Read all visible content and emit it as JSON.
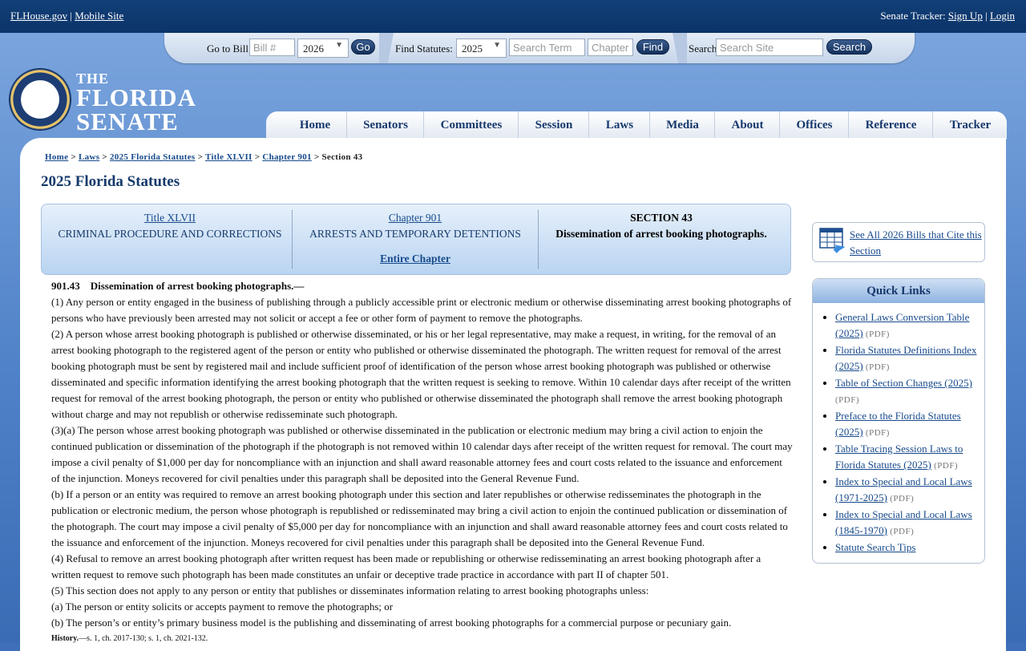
{
  "top": {
    "flhouse": "FLHouse.gov",
    "sep": "|",
    "mobile": "Mobile Site",
    "tracker_label": "Senate Tracker:",
    "sign_up": "Sign Up",
    "login": "Login"
  },
  "searchbar": {
    "goto_bill": "Go to Bill:",
    "bill_placeholder": "Bill #",
    "bill_year": "2026",
    "go": "Go",
    "find_statutes": "Find Statutes:",
    "statute_year": "2025",
    "term_placeholder": "Search Term",
    "chapter_placeholder": "Chapter",
    "find": "Find",
    "search_label": "Search",
    "site_placeholder": "Search Site",
    "search_btn": "Search"
  },
  "logo": {
    "the": "THE",
    "florida": "FLORIDA",
    "senate": "SENATE"
  },
  "nav": [
    "Home",
    "Senators",
    "Committees",
    "Session",
    "Laws",
    "Media",
    "About",
    "Offices",
    "Reference",
    "Tracker"
  ],
  "breadcrumb": {
    "items": [
      "Home",
      "Laws",
      "2025 Florida Statutes",
      "Title XLVII",
      "Chapter 901"
    ],
    "sep": ">",
    "current": "Section 43"
  },
  "page_title": "2025 Florida Statutes",
  "info": {
    "title_link": "Title XLVII",
    "title_name": "CRIMINAL PROCEDURE AND CORRECTIONS",
    "chapter_link": "Chapter 901",
    "chapter_name": "ARRESTS AND TEMPORARY DETENTIONS",
    "entire_chapter": "Entire Chapter",
    "section_label": "SECTION 43",
    "section_name": "Dissemination of arrest booking photographs."
  },
  "statute": {
    "heading_num": "901.43",
    "heading_title": "Dissemination of arrest booking photographs.—",
    "p1": "(1)    Any person or entity engaged in the business of publishing through a publicly accessible print or electronic medium or otherwise disseminating arrest booking photographs of persons who have previously been arrested may not solicit or accept a fee or other form of payment to remove the photographs.",
    "p2": "(2)    A person whose arrest booking photograph is published or otherwise disseminated, or his or her legal representative, may make a request, in writing, for the removal of an arrest booking photograph to the registered agent of the person or entity who published or otherwise disseminated the photograph. The written request for removal of the arrest booking photograph must be sent by registered mail and include sufficient proof of identification of the person whose arrest booking photograph was published or otherwise disseminated and specific information identifying the arrest booking photograph that the written request is seeking to remove. Within 10 calendar days after receipt of the written request for removal of the arrest booking photograph, the person or entity who published or otherwise disseminated the photograph shall remove the arrest booking photograph without charge and may not republish or otherwise redisseminate such photograph.",
    "p3a": "(3)(a)    The person whose arrest booking photograph was published or otherwise disseminated in the publication or electronic medium may bring a civil action to enjoin the continued publication or dissemination of the photograph if the photograph is not removed within 10 calendar days after receipt of the written request for removal. The court may impose a civil penalty of $1,000 per day for noncompliance with an injunction and shall award reasonable attorney fees and court costs related to the issuance and enforcement of the injunction. Moneys recovered for civil penalties under this paragraph shall be deposited into the General Revenue Fund.",
    "p3b": "(b)    If a person or an entity was required to remove an arrest booking photograph under this section and later republishes or otherwise redisseminates the photograph in the publication or electronic medium, the person whose photograph is republished or redisseminated may bring a civil action to enjoin the continued publication or dissemination of the photograph. The court may impose a civil penalty of $5,000 per day for noncompliance with an injunction and shall award reasonable attorney fees and court costs related to the issuance and enforcement of the injunction. Moneys recovered for civil penalties under this paragraph shall be deposited into the General Revenue Fund.",
    "p4": "(4)    Refusal to remove an arrest booking photograph after written request has been made or republishing or otherwise redisseminating an arrest booking photograph after a written request to remove such photograph has been made constitutes an unfair or deceptive trade practice in accordance with part II of chapter 501.",
    "p5": "(5)    This section does not apply to any person or entity that publishes or disseminates information relating to arrest booking photographs unless:",
    "p5a": "(a)    The person or entity solicits or accepts payment to remove the photographs; or",
    "p5b": "(b)    The person’s or entity’s primary business model is the publishing and disseminating of arrest booking photographs for a commercial purpose or pecuniary gain.",
    "history_label": "History.",
    "history_text": "—s. 1, ch. 2017-130; s. 1, ch. 2021-132."
  },
  "cite": {
    "label": "See All 2026 Bills that Cite this Section"
  },
  "quick_links": {
    "title": "Quick Links",
    "pdf": "(PDF)",
    "items": [
      "General Laws Conversion Table (2025)",
      "Florida Statutes Definitions Index (2025)",
      "Table of Section Changes (2025)",
      "Preface to the Florida Statutes (2025)",
      "Table Tracing Session Laws to Florida Statutes (2025)",
      "Index to Special and Local Laws (1971-2025)",
      "Index to Special and Local Laws (1845-1970)",
      "Statute Search Tips"
    ]
  },
  "colors": {
    "header": "#0b3468",
    "link": "#174a8c",
    "title": "#163a6c"
  }
}
